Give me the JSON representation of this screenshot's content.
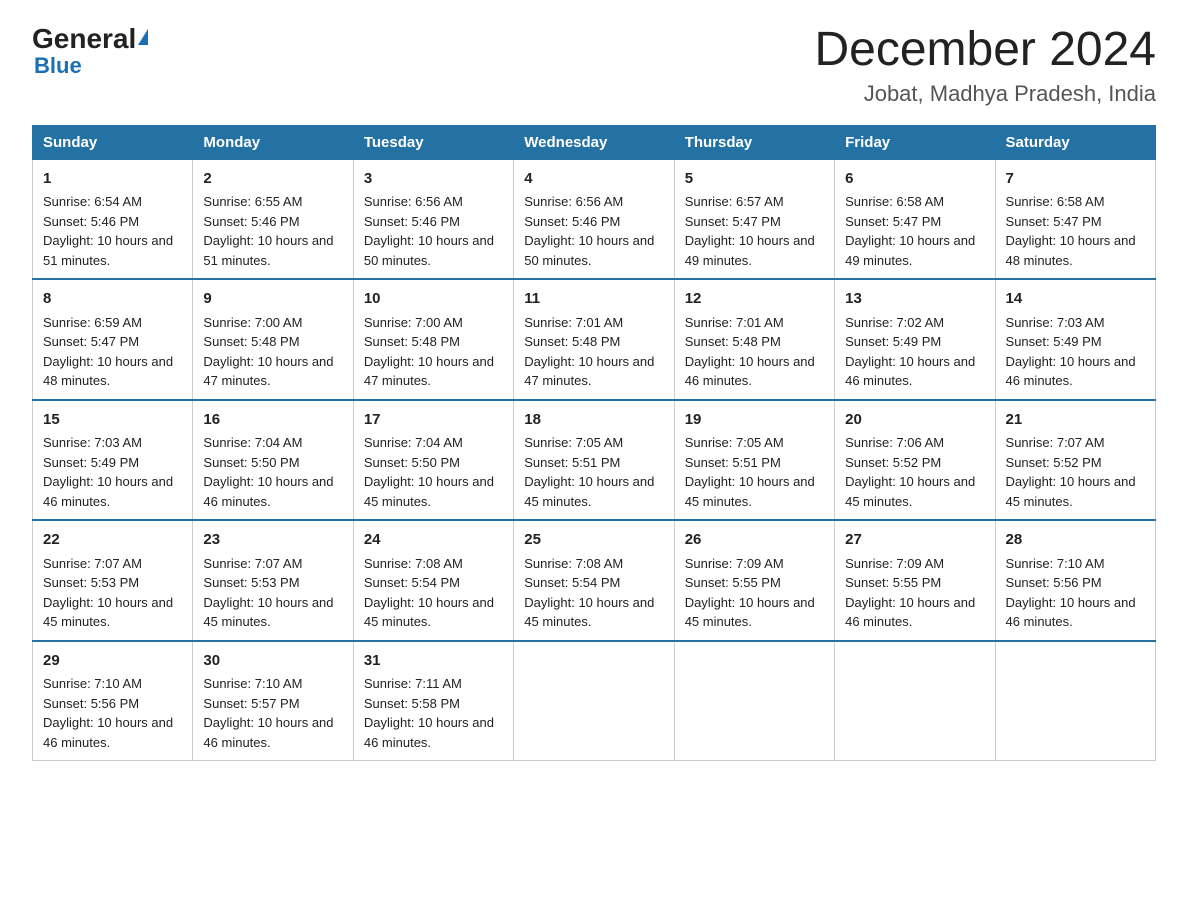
{
  "logo": {
    "general": "General",
    "blue": "Blue",
    "triangle": "▲"
  },
  "title": "December 2024",
  "subtitle": "Jobat, Madhya Pradesh, India",
  "days_header": [
    "Sunday",
    "Monday",
    "Tuesday",
    "Wednesday",
    "Thursday",
    "Friday",
    "Saturday"
  ],
  "weeks": [
    [
      {
        "day": "1",
        "sunrise": "6:54 AM",
        "sunset": "5:46 PM",
        "daylight": "10 hours and 51 minutes."
      },
      {
        "day": "2",
        "sunrise": "6:55 AM",
        "sunset": "5:46 PM",
        "daylight": "10 hours and 51 minutes."
      },
      {
        "day": "3",
        "sunrise": "6:56 AM",
        "sunset": "5:46 PM",
        "daylight": "10 hours and 50 minutes."
      },
      {
        "day": "4",
        "sunrise": "6:56 AM",
        "sunset": "5:46 PM",
        "daylight": "10 hours and 50 minutes."
      },
      {
        "day": "5",
        "sunrise": "6:57 AM",
        "sunset": "5:47 PM",
        "daylight": "10 hours and 49 minutes."
      },
      {
        "day": "6",
        "sunrise": "6:58 AM",
        "sunset": "5:47 PM",
        "daylight": "10 hours and 49 minutes."
      },
      {
        "day": "7",
        "sunrise": "6:58 AM",
        "sunset": "5:47 PM",
        "daylight": "10 hours and 48 minutes."
      }
    ],
    [
      {
        "day": "8",
        "sunrise": "6:59 AM",
        "sunset": "5:47 PM",
        "daylight": "10 hours and 48 minutes."
      },
      {
        "day": "9",
        "sunrise": "7:00 AM",
        "sunset": "5:48 PM",
        "daylight": "10 hours and 47 minutes."
      },
      {
        "day": "10",
        "sunrise": "7:00 AM",
        "sunset": "5:48 PM",
        "daylight": "10 hours and 47 minutes."
      },
      {
        "day": "11",
        "sunrise": "7:01 AM",
        "sunset": "5:48 PM",
        "daylight": "10 hours and 47 minutes."
      },
      {
        "day": "12",
        "sunrise": "7:01 AM",
        "sunset": "5:48 PM",
        "daylight": "10 hours and 46 minutes."
      },
      {
        "day": "13",
        "sunrise": "7:02 AM",
        "sunset": "5:49 PM",
        "daylight": "10 hours and 46 minutes."
      },
      {
        "day": "14",
        "sunrise": "7:03 AM",
        "sunset": "5:49 PM",
        "daylight": "10 hours and 46 minutes."
      }
    ],
    [
      {
        "day": "15",
        "sunrise": "7:03 AM",
        "sunset": "5:49 PM",
        "daylight": "10 hours and 46 minutes."
      },
      {
        "day": "16",
        "sunrise": "7:04 AM",
        "sunset": "5:50 PM",
        "daylight": "10 hours and 46 minutes."
      },
      {
        "day": "17",
        "sunrise": "7:04 AM",
        "sunset": "5:50 PM",
        "daylight": "10 hours and 45 minutes."
      },
      {
        "day": "18",
        "sunrise": "7:05 AM",
        "sunset": "5:51 PM",
        "daylight": "10 hours and 45 minutes."
      },
      {
        "day": "19",
        "sunrise": "7:05 AM",
        "sunset": "5:51 PM",
        "daylight": "10 hours and 45 minutes."
      },
      {
        "day": "20",
        "sunrise": "7:06 AM",
        "sunset": "5:52 PM",
        "daylight": "10 hours and 45 minutes."
      },
      {
        "day": "21",
        "sunrise": "7:07 AM",
        "sunset": "5:52 PM",
        "daylight": "10 hours and 45 minutes."
      }
    ],
    [
      {
        "day": "22",
        "sunrise": "7:07 AM",
        "sunset": "5:53 PM",
        "daylight": "10 hours and 45 minutes."
      },
      {
        "day": "23",
        "sunrise": "7:07 AM",
        "sunset": "5:53 PM",
        "daylight": "10 hours and 45 minutes."
      },
      {
        "day": "24",
        "sunrise": "7:08 AM",
        "sunset": "5:54 PM",
        "daylight": "10 hours and 45 minutes."
      },
      {
        "day": "25",
        "sunrise": "7:08 AM",
        "sunset": "5:54 PM",
        "daylight": "10 hours and 45 minutes."
      },
      {
        "day": "26",
        "sunrise": "7:09 AM",
        "sunset": "5:55 PM",
        "daylight": "10 hours and 45 minutes."
      },
      {
        "day": "27",
        "sunrise": "7:09 AM",
        "sunset": "5:55 PM",
        "daylight": "10 hours and 46 minutes."
      },
      {
        "day": "28",
        "sunrise": "7:10 AM",
        "sunset": "5:56 PM",
        "daylight": "10 hours and 46 minutes."
      }
    ],
    [
      {
        "day": "29",
        "sunrise": "7:10 AM",
        "sunset": "5:56 PM",
        "daylight": "10 hours and 46 minutes."
      },
      {
        "day": "30",
        "sunrise": "7:10 AM",
        "sunset": "5:57 PM",
        "daylight": "10 hours and 46 minutes."
      },
      {
        "day": "31",
        "sunrise": "7:11 AM",
        "sunset": "5:58 PM",
        "daylight": "10 hours and 46 minutes."
      },
      null,
      null,
      null,
      null
    ]
  ],
  "labels": {
    "sunrise": "Sunrise:",
    "sunset": "Sunset:",
    "daylight": "Daylight:"
  }
}
